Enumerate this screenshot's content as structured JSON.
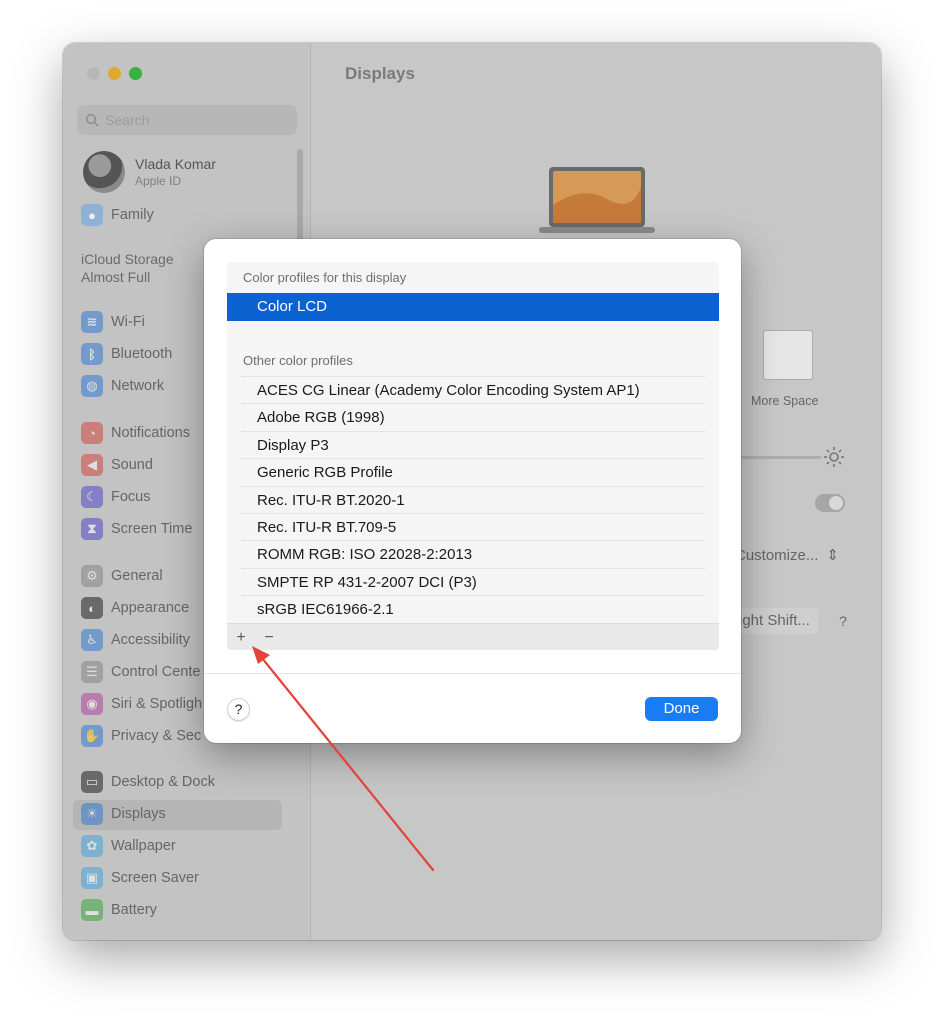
{
  "window": {
    "title": "Displays",
    "search_placeholder": "Search"
  },
  "sidebar": {
    "profile": {
      "name": "Vlada Komar",
      "subtitle": "Apple ID"
    },
    "family": "Family",
    "icloud_line1": "iCloud Storage",
    "icloud_line2": "Almost Full",
    "items": [
      {
        "label": "Wi-Fi",
        "icon": "wifi-icon",
        "color": "#3f7fd0"
      },
      {
        "label": "Bluetooth",
        "icon": "bluetooth-icon",
        "color": "#3f7fd0"
      },
      {
        "label": "Network",
        "icon": "globe-icon",
        "color": "#3f7fd0"
      },
      {
        "label": "Notifications",
        "icon": "bell-icon",
        "color": "#d0524b"
      },
      {
        "label": "Sound",
        "icon": "speaker-icon",
        "color": "#d0524b"
      },
      {
        "label": "Focus",
        "icon": "moon-icon",
        "color": "#5c53c8"
      },
      {
        "label": "Screen Time",
        "icon": "hourglass-icon",
        "color": "#5c53c8"
      },
      {
        "label": "General",
        "icon": "gear-icon",
        "color": "#8c8c8c"
      },
      {
        "label": "Appearance",
        "icon": "appearance-icon",
        "color": "#2e2e2e"
      },
      {
        "label": "Accessibility",
        "icon": "accessibility-icon",
        "color": "#3f7fd0"
      },
      {
        "label": "Control Cente",
        "icon": "control-center-icon",
        "color": "#8c8c8c"
      },
      {
        "label": "Siri & Spotligh",
        "icon": "siri-icon",
        "color": "#b24fa0"
      },
      {
        "label": "Privacy & Sec",
        "icon": "hand-icon",
        "color": "#3f7fd0"
      },
      {
        "label": "Desktop & Dock",
        "icon": "dock-icon",
        "color": "#2e2e2e"
      },
      {
        "label": "Displays",
        "icon": "sun-icon",
        "color": "#3f7fd0"
      },
      {
        "label": "Wallpaper",
        "icon": "wallpaper-icon",
        "color": "#4ea6d8"
      },
      {
        "label": "Screen Saver",
        "icon": "screensaver-icon",
        "color": "#4ea6d8"
      },
      {
        "label": "Battery",
        "icon": "battery-icon",
        "color": "#46a844"
      }
    ]
  },
  "main": {
    "more_space": "More Space",
    "customize": "Customize...",
    "night_shift": "ight Shift...",
    "help": "?"
  },
  "dialog": {
    "header_this_display": "Color profiles for this display",
    "selected_profile": "Color LCD",
    "header_other": "Other color profiles",
    "profiles": [
      "ACES CG Linear (Academy Color Encoding System AP1)",
      "Adobe RGB (1998)",
      "Display P3",
      "Generic RGB Profile",
      "Rec. ITU-R BT.2020-1",
      "Rec. ITU-R BT.709-5",
      "ROMM RGB: ISO 22028-2:2013",
      "SMPTE RP 431-2-2007 DCI (P3)",
      "sRGB IEC61966-2.1"
    ],
    "add_label": "+",
    "remove_label": "−",
    "help_label": "?",
    "done_label": "Done"
  },
  "colors": {
    "accent": "#0a63d1",
    "done_button": "#1a7cf5",
    "annotation_arrow": "#e0443a"
  }
}
